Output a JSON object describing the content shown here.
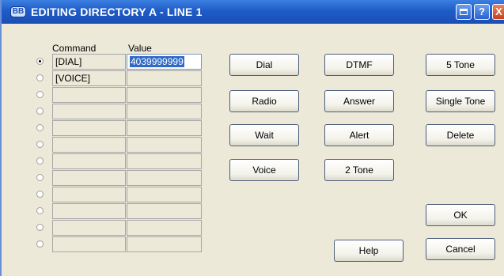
{
  "window": {
    "title": "EDITING DIRECTORY A - LINE 1",
    "app_icon_text": "BB"
  },
  "titlebar_buttons": {
    "help": "?",
    "close": "X"
  },
  "table": {
    "headers": {
      "command": "Command",
      "value": "Value"
    },
    "selected_row": 0,
    "rows": [
      {
        "command": "[DIAL]",
        "value": "4039999999"
      },
      {
        "command": "[VOICE]",
        "value": ""
      },
      {
        "command": "",
        "value": ""
      },
      {
        "command": "",
        "value": ""
      },
      {
        "command": "",
        "value": ""
      },
      {
        "command": "",
        "value": ""
      },
      {
        "command": "",
        "value": ""
      },
      {
        "command": "",
        "value": ""
      },
      {
        "command": "",
        "value": ""
      },
      {
        "command": "",
        "value": ""
      },
      {
        "command": "",
        "value": ""
      },
      {
        "command": "",
        "value": ""
      }
    ]
  },
  "buttons": {
    "dial": "Dial",
    "radio": "Radio",
    "wait": "Wait",
    "voice": "Voice",
    "dtmf": "DTMF",
    "answer": "Answer",
    "alert": "Alert",
    "two_tone": "2 Tone",
    "five_tone": "5 Tone",
    "single_tone": "Single Tone",
    "delete": "Delete",
    "ok": "OK",
    "help": "Help",
    "cancel": "Cancel"
  }
}
